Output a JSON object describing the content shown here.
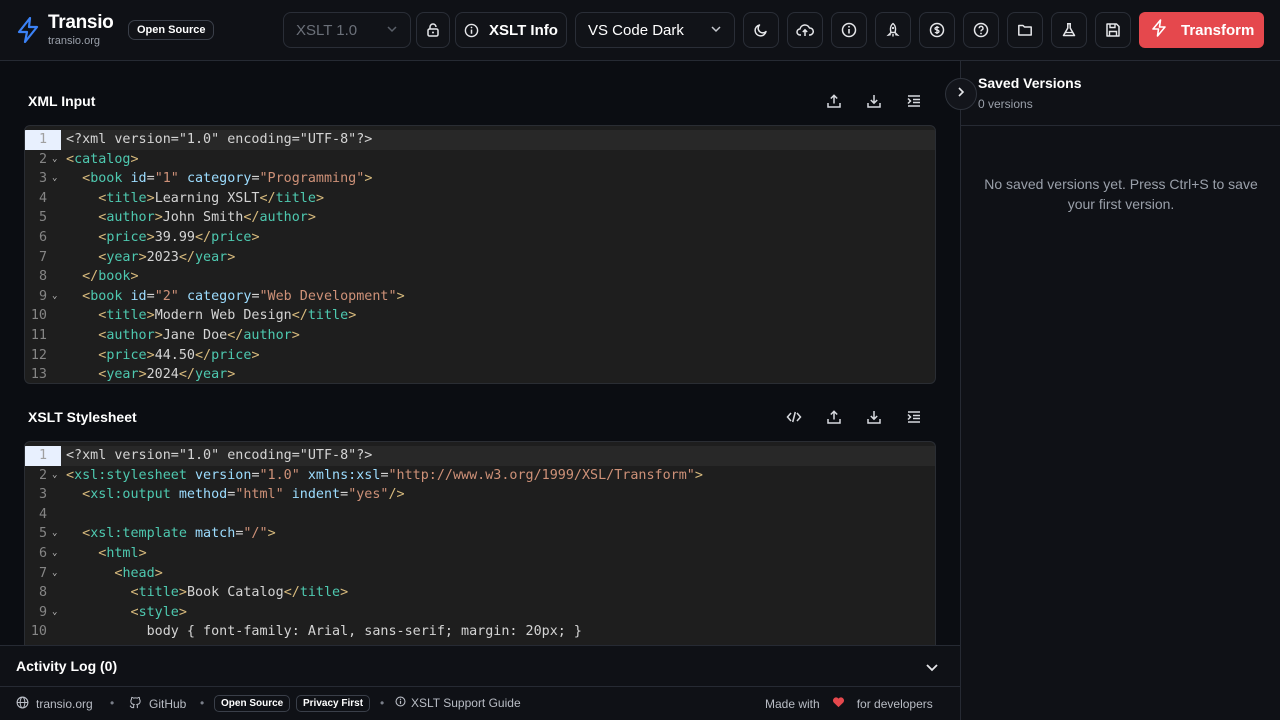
{
  "header": {
    "brand": "Transio",
    "brand_sub": "transio.org",
    "badge": "Open Source",
    "version_select": "XSLT 1.0",
    "info_label": "XSLT Info",
    "theme_select": "VS Code Dark",
    "transform_label": "Transform"
  },
  "xml_section": {
    "title": "XML Input",
    "lines": [
      "<?xml version=\"1.0\" encoding=\"UTF-8\"?>",
      "<catalog>",
      "  <book id=\"1\" category=\"Programming\">",
      "    <title>Learning XSLT</title>",
      "    <author>John Smith</author>",
      "    <price>39.99</price>",
      "    <year>2023</year>",
      "  </book>",
      "  <book id=\"2\" category=\"Web Development\">",
      "    <title>Modern Web Design</title>",
      "    <author>Jane Doe</author>",
      "    <price>44.50</price>",
      "    <year>2024</year>"
    ]
  },
  "xslt_section": {
    "title": "XSLT Stylesheet",
    "lines": [
      "<?xml version=\"1.0\" encoding=\"UTF-8\"?>",
      "<xsl:stylesheet version=\"1.0\" xmlns:xsl=\"http://www.w3.org/1999/XSL/Transform\">",
      "  <xsl:output method=\"html\" indent=\"yes\"/>",
      "",
      "  <xsl:template match=\"/\">",
      "    <html>",
      "      <head>",
      "        <title>Book Catalog</title>",
      "        <style>",
      "          body { font-family: Arial, sans-serif; margin: 20px; }"
    ]
  },
  "activity": {
    "title": "Activity Log (0)"
  },
  "footer": {
    "site": "transio.org",
    "github": "GitHub",
    "badge_open": "Open Source",
    "badge_privacy": "Privacy First",
    "guide": "XSLT Support Guide",
    "made_with": "Made with",
    "for_devs": "for developers"
  },
  "sidebar": {
    "title": "Saved Versions",
    "count": "0 versions",
    "empty": "No saved versions yet. Press Ctrl+S to save your first version."
  },
  "colors": {
    "accent": "#e5484d",
    "logo": "#3b82f6",
    "editor_bg": "#1e1e1e"
  }
}
